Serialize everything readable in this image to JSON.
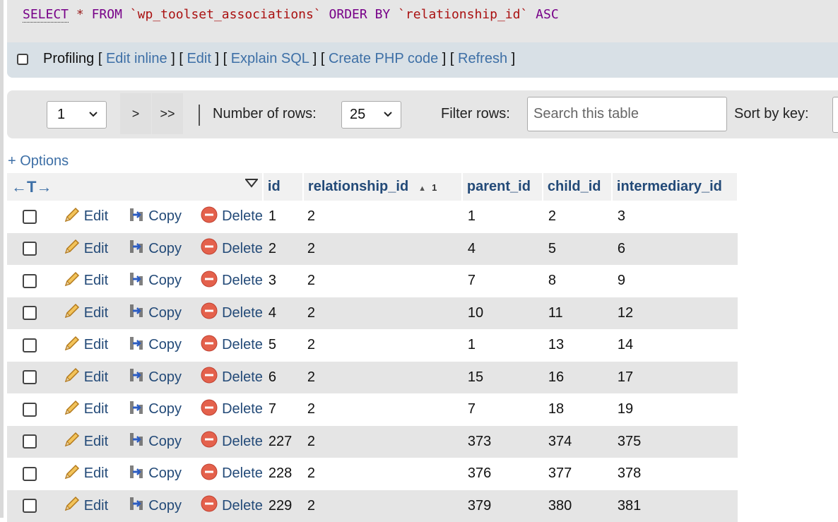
{
  "sql": {
    "select": "SELECT",
    "star": "*",
    "from": "FROM",
    "table": "`wp_toolset_associations`",
    "order_by": "ORDER BY",
    "column": "`relationship_id`",
    "dir": "ASC"
  },
  "sql_bar": {
    "profiling": "Profiling",
    "links": [
      "Edit inline",
      "Edit",
      "Explain SQL",
      "Create PHP code",
      "Refresh"
    ]
  },
  "nav": {
    "page_value": "1",
    "next": ">",
    "last": ">>",
    "rows_label": "Number of rows:",
    "rows_value": "25",
    "filter_label": "Filter rows:",
    "search_placeholder": "Search this table",
    "sort_label": "Sort by key:"
  },
  "options_label": "+ Options",
  "table": {
    "arrows": "←T→",
    "columns": [
      "id",
      "relationship_id",
      "parent_id",
      "child_id",
      "intermediary_id"
    ],
    "sort_index": "1",
    "actions": {
      "edit": "Edit",
      "copy": "Copy",
      "delete": "Delete"
    },
    "rows": [
      [
        "1",
        "2",
        "1",
        "2",
        "3"
      ],
      [
        "2",
        "2",
        "4",
        "5",
        "6"
      ],
      [
        "3",
        "2",
        "7",
        "8",
        "9"
      ],
      [
        "4",
        "2",
        "10",
        "11",
        "12"
      ],
      [
        "5",
        "2",
        "1",
        "13",
        "14"
      ],
      [
        "6",
        "2",
        "15",
        "16",
        "17"
      ],
      [
        "7",
        "2",
        "7",
        "18",
        "19"
      ],
      [
        "227",
        "2",
        "373",
        "374",
        "375"
      ],
      [
        "228",
        "2",
        "376",
        "377",
        "378"
      ],
      [
        "229",
        "2",
        "379",
        "380",
        "381"
      ]
    ]
  }
}
